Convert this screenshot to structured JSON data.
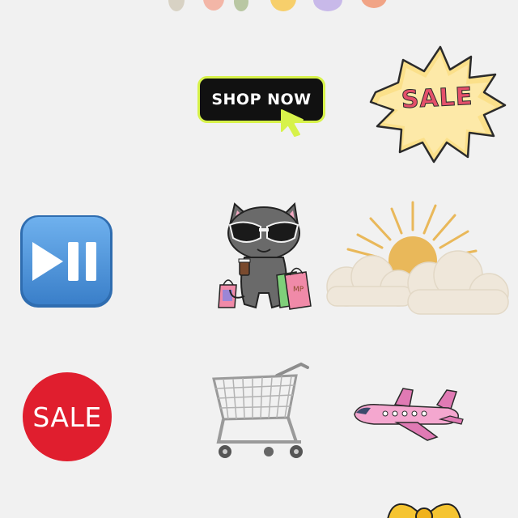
{
  "stickers": {
    "shop_now": {
      "label": "SHOP NOW",
      "icon": "cursor-pointer-icon",
      "colors": {
        "fill": "#111111",
        "border": "#d7f24a",
        "text": "#ffffff"
      }
    },
    "sale_burst": {
      "label": "SALE",
      "icon": "starburst-icon",
      "colors": {
        "fill": "#fbe08a",
        "text": "#e4506a",
        "outline": "#2b2b2b"
      }
    },
    "play_pause": {
      "icon": "play-pause-icon",
      "colors": {
        "fill": "#4a8fd8",
        "symbol": "#ffffff"
      }
    },
    "cat_shopping": {
      "icon": "cat-shopping-icon",
      "bag_text": "MP",
      "colors": {
        "body": "#6a6a6a",
        "bag_pink": "#f08aa8",
        "bag_green": "#7fcf7a"
      }
    },
    "sun_clouds": {
      "icon": "sun-clouds-icon",
      "colors": {
        "sun": "#e9b85a",
        "cloud": "#efe7da"
      }
    },
    "sale_circle": {
      "label": "SALE",
      "icon": "sale-circle-icon",
      "colors": {
        "fill": "#e01e2e",
        "text": "#ffffff"
      }
    },
    "shopping_cart": {
      "icon": "shopping-cart-icon",
      "colors": {
        "frame": "#9a9a9a",
        "wheel": "#555555"
      }
    },
    "airplane": {
      "icon": "airplane-icon",
      "colors": {
        "body": "#f4a7cf",
        "wing": "#e07ab4"
      }
    },
    "partial_top": {
      "icon": "partial-stickers-icon"
    },
    "partial_bottom": {
      "icon": "partial-bow-icon"
    }
  }
}
